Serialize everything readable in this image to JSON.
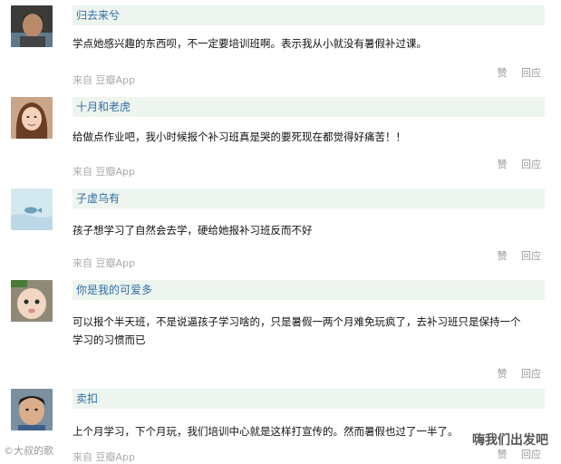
{
  "comments": [
    {
      "user": "归去来兮",
      "text": "学点她感兴趣的东西呗，不一定要培训班啊。表示我从小就没有暑假补过课。",
      "source": "来自 豆瓣App",
      "like": "赞",
      "reply": "回应"
    },
    {
      "user": "十月和老虎",
      "text": "给做点作业吧，我小时候报个补习班真是哭的要死现在都觉得好痛苦！！",
      "source": "来自 豆瓣App",
      "like": "赞",
      "reply": "回应"
    },
    {
      "user": "子虚乌有",
      "text": "孩子想学习了自然会去学，硬给她报补习班反而不好",
      "source": "来自 豆瓣App",
      "like": "赞",
      "reply": "回应"
    },
    {
      "user": "你是我的可爱多",
      "text_line1": "可以报个半天班，不是说逼孩子学习啥的，只是暑假一两个月难免玩疯了，去补习班只是保持一个",
      "text_line2": "学习的习惯而已",
      "source": "来自 豆瓣App",
      "like": "赞",
      "reply": "回应"
    },
    {
      "user": "卖扣",
      "text": "上个月学习，下个月玩，我们培训中心就是这样打宣传的。然而暑假也过了一半了。",
      "source": "来自 豆瓣App",
      "like": "赞",
      "reply": "回应"
    }
  ],
  "watermark_left": "©大叔的歌",
  "watermark_right": "嗨我们出发吧"
}
